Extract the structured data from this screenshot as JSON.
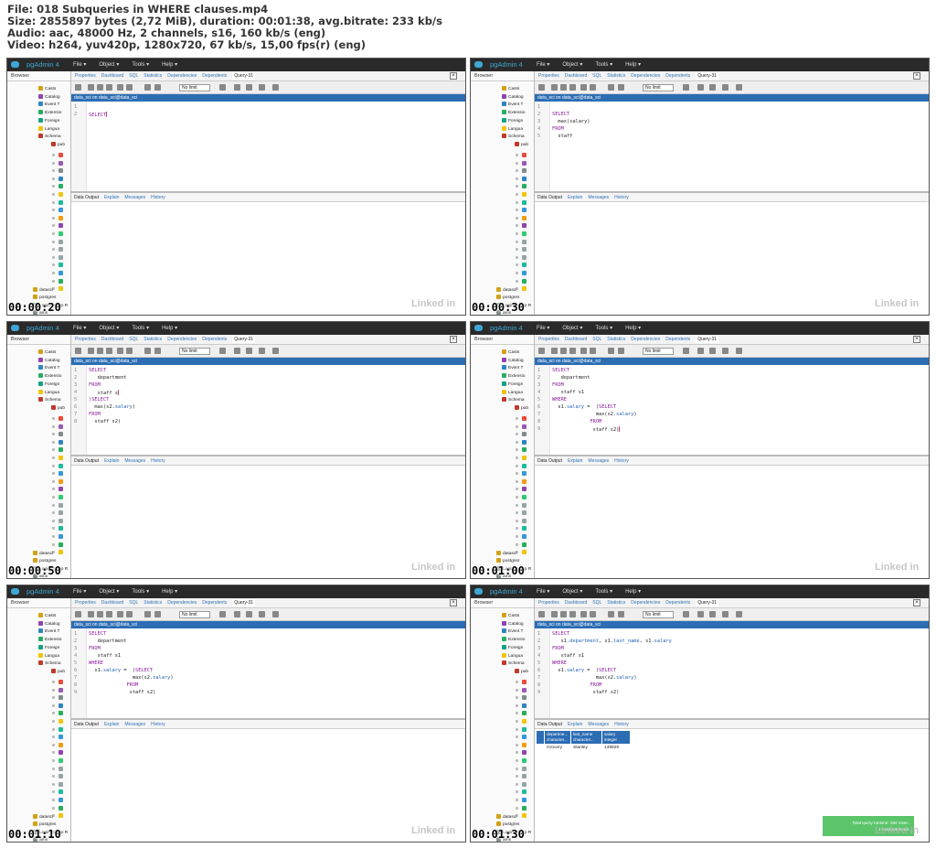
{
  "header": {
    "file_line": "File: 018 Subqueries in WHERE clauses.mp4",
    "size_line": "Size: 2855897 bytes (2,72 MiB), duration: 00:01:38, avg.bitrate: 233 kb/s",
    "audio_line": "Audio: aac, 48000 Hz, 2 channels, s16, 160 kb/s (eng)",
    "video_line": "Video: h264, yuv420p, 1280x720, 67 kb/s, 15,00 fps(r) (eng)"
  },
  "app": {
    "logo_text": "pgAdmin 4",
    "menu": [
      "File ▾",
      "Object ▾",
      "Tools ▾",
      "Help ▾"
    ],
    "browser_label": "Browser",
    "tabs": [
      "Properties",
      "Dashboard",
      "SQL",
      "Statistics",
      "Dependencies",
      "Dependents",
      "Query-31"
    ],
    "no_limit": "No limit",
    "connection": "data_sci on data_sci@data_sci",
    "result_tabs": [
      "Data Output",
      "Explain",
      "Messages",
      "History"
    ],
    "tree_items": [
      "Casts",
      "Catalog",
      "Event T",
      "Extensio",
      "Foreign",
      "Langua",
      "Schema",
      "pub"
    ],
    "tree_bottom": [
      "datasci",
      "postgres",
      "Login/Group R",
      "ams"
    ],
    "watermark": "Linked in"
  },
  "frames": [
    {
      "timestamp": "00:00:20",
      "lines": [
        {
          "n": "1",
          "segs": []
        },
        {
          "n": "2",
          "segs": [
            {
              "t": "SELECT",
              "c": "kw"
            }
          ]
        }
      ],
      "cursor_line": 1,
      "results": null
    },
    {
      "timestamp": "00:00:30",
      "lines": [
        {
          "n": "1",
          "segs": []
        },
        {
          "n": "2",
          "segs": [
            {
              "t": "SELECT",
              "c": "kw"
            }
          ]
        },
        {
          "n": "3",
          "segs": [
            {
              "t": "  max(salary)",
              "c": ""
            }
          ]
        },
        {
          "n": "4",
          "segs": [
            {
              "t": "FROM",
              "c": "kw"
            }
          ]
        },
        {
          "n": "5",
          "segs": [
            {
              "t": "  staff",
              "c": ""
            }
          ]
        }
      ],
      "cursor_line": -1,
      "results": null
    },
    {
      "timestamp": "00:00:50",
      "lines": [
        {
          "n": "1",
          "segs": [
            {
              "t": "SELECT",
              "c": "kw"
            }
          ]
        },
        {
          "n": "2",
          "segs": [
            {
              "t": "   department",
              "c": ""
            }
          ]
        },
        {
          "n": "3",
          "segs": [
            {
              "t": "FROM",
              "c": "kw"
            }
          ]
        },
        {
          "n": "4",
          "segs": [
            {
              "t": "   staff s",
              "c": ""
            }
          ]
        },
        {
          "n": "5",
          "segs": [
            {
              "t": "(SELECT",
              "c": "kw"
            }
          ]
        },
        {
          "n": "6",
          "segs": [
            {
              "t": "  max(s2.",
              "c": ""
            },
            {
              "t": "salary",
              "c": "col"
            },
            {
              "t": ")",
              "c": ""
            }
          ]
        },
        {
          "n": "7",
          "segs": [
            {
              "t": "FROM",
              "c": "kw"
            }
          ]
        },
        {
          "n": "8",
          "segs": [
            {
              "t": "  staff s2)",
              "c": ""
            }
          ]
        }
      ],
      "cursor_line": 3,
      "results": null
    },
    {
      "timestamp": "00:01:00",
      "lines": [
        {
          "n": "1",
          "segs": [
            {
              "t": "SELECT",
              "c": "kw"
            }
          ]
        },
        {
          "n": "2",
          "segs": [
            {
              "t": "   department",
              "c": ""
            }
          ]
        },
        {
          "n": "3",
          "segs": [
            {
              "t": "FROM",
              "c": "kw"
            }
          ]
        },
        {
          "n": "4",
          "segs": [
            {
              "t": "   staff s1",
              "c": ""
            }
          ]
        },
        {
          "n": "5",
          "segs": [
            {
              "t": "WHERE",
              "c": "kw"
            }
          ]
        },
        {
          "n": "6",
          "segs": [
            {
              "t": "  s1.",
              "c": ""
            },
            {
              "t": "salary",
              "c": "col"
            },
            {
              "t": " =  (",
              "c": ""
            },
            {
              "t": "SELECT",
              "c": "kw"
            }
          ]
        },
        {
          "n": "7",
          "segs": [
            {
              "t": "               max(s2.",
              "c": ""
            },
            {
              "t": "salary",
              "c": "col"
            },
            {
              "t": ")",
              "c": ""
            }
          ]
        },
        {
          "n": "8",
          "segs": [
            {
              "t": "             FROM",
              "c": "kw"
            }
          ]
        },
        {
          "n": "9",
          "segs": [
            {
              "t": "              staff s2)",
              "c": ""
            }
          ]
        }
      ],
      "cursor_line": 8,
      "results": null
    },
    {
      "timestamp": "00:01:10",
      "lines": [
        {
          "n": "1",
          "segs": [
            {
              "t": "SELECT",
              "c": "kw"
            }
          ]
        },
        {
          "n": "2",
          "segs": [
            {
              "t": "   department",
              "c": ""
            }
          ]
        },
        {
          "n": "3",
          "segs": [
            {
              "t": "FROM",
              "c": "kw"
            }
          ]
        },
        {
          "n": "4",
          "segs": [
            {
              "t": "   staff s1",
              "c": ""
            }
          ]
        },
        {
          "n": "5",
          "segs": [
            {
              "t": "WHERE",
              "c": "kw"
            }
          ]
        },
        {
          "n": "6",
          "segs": [
            {
              "t": "  s1.",
              "c": ""
            },
            {
              "t": "salary",
              "c": "col"
            },
            {
              "t": " =  (",
              "c": ""
            },
            {
              "t": "SELECT",
              "c": "kw"
            }
          ]
        },
        {
          "n": "7",
          "segs": [
            {
              "t": "               max(s2.",
              "c": ""
            },
            {
              "t": "salary",
              "c": "col"
            },
            {
              "t": ")",
              "c": ""
            }
          ]
        },
        {
          "n": "8",
          "segs": [
            {
              "t": "             FROM",
              "c": "kw"
            }
          ]
        },
        {
          "n": "9",
          "segs": [
            {
              "t": "              staff s2)",
              "c": ""
            }
          ]
        }
      ],
      "cursor_line": -1,
      "results": null
    },
    {
      "timestamp": "00:01:30",
      "lines": [
        {
          "n": "1",
          "segs": [
            {
              "t": "SELECT",
              "c": "kw"
            }
          ]
        },
        {
          "n": "2",
          "segs": [
            {
              "t": "   s1.",
              "c": ""
            },
            {
              "t": "department",
              "c": "col"
            },
            {
              "t": ", s1.",
              "c": ""
            },
            {
              "t": "last_name",
              "c": "col"
            },
            {
              "t": ", s1.",
              "c": ""
            },
            {
              "t": "salary",
              "c": "col"
            }
          ]
        },
        {
          "n": "3",
          "segs": [
            {
              "t": "FROM",
              "c": "kw"
            }
          ]
        },
        {
          "n": "4",
          "segs": [
            {
              "t": "   staff s1",
              "c": ""
            }
          ]
        },
        {
          "n": "5",
          "segs": [
            {
              "t": "WHERE",
              "c": "kw"
            }
          ]
        },
        {
          "n": "6",
          "segs": [
            {
              "t": "  s1.",
              "c": ""
            },
            {
              "t": "salary",
              "c": "col"
            },
            {
              "t": " =  (",
              "c": ""
            },
            {
              "t": "SELECT",
              "c": "kw"
            }
          ]
        },
        {
          "n": "7",
          "segs": [
            {
              "t": "               max(s2.",
              "c": ""
            },
            {
              "t": "salary",
              "c": "col"
            },
            {
              "t": ")",
              "c": ""
            }
          ]
        },
        {
          "n": "8",
          "segs": [
            {
              "t": "             FROM",
              "c": "kw"
            }
          ]
        },
        {
          "n": "9",
          "segs": [
            {
              "t": "              staff s2)",
              "c": ""
            }
          ]
        }
      ],
      "cursor_line": -1,
      "results": {
        "columns": [
          {
            "name": "departme...",
            "type": "character..."
          },
          {
            "name": "last_name",
            "type": "character..."
          },
          {
            "name": "salary",
            "type": "integer"
          }
        ],
        "row": [
          "Grocery",
          "Stanley",
          "149929"
        ],
        "toast_line1": "Total query runtime: 184 msec.",
        "toast_line2": "1 rows retrieved."
      }
    }
  ]
}
